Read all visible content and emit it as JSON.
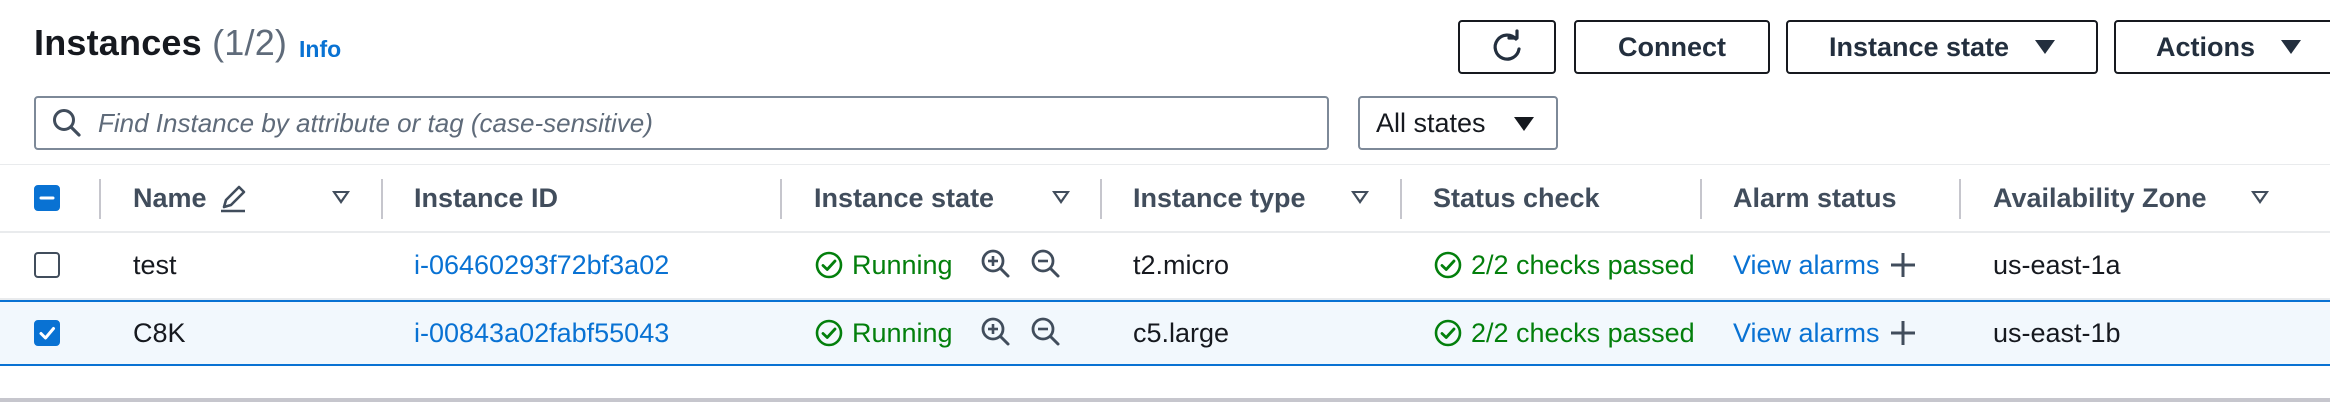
{
  "header": {
    "title": "Instances",
    "count": "(1/2)",
    "info": "Info"
  },
  "toolbar": {
    "refresh_icon": "refresh-icon",
    "connect": "Connect",
    "instance_state": "Instance state",
    "actions": "Actions"
  },
  "search": {
    "placeholder": "Find Instance by attribute or tag (case-sensitive)"
  },
  "filter": {
    "selected": "All states"
  },
  "table": {
    "columns": [
      "Name",
      "Instance ID",
      "Instance state",
      "Instance type",
      "Status check",
      "Alarm status",
      "Availability Zone"
    ],
    "rows": [
      {
        "selected": false,
        "name": "test",
        "instance_id": "i-06460293f72bf3a02",
        "state": "Running",
        "type": "t2.micro",
        "status_check": "2/2 checks passed",
        "alarm": "View alarms",
        "zone": "us-east-1a"
      },
      {
        "selected": true,
        "name": "C8K",
        "instance_id": "i-00843a02fabf55043",
        "state": "Running",
        "type": "c5.large",
        "status_check": "2/2 checks passed",
        "alarm": "View alarms",
        "zone": "us-east-1b"
      }
    ]
  },
  "colors": {
    "link": "#0972d3",
    "success": "#037f0c",
    "selected_bg": "#f2f8fd"
  }
}
